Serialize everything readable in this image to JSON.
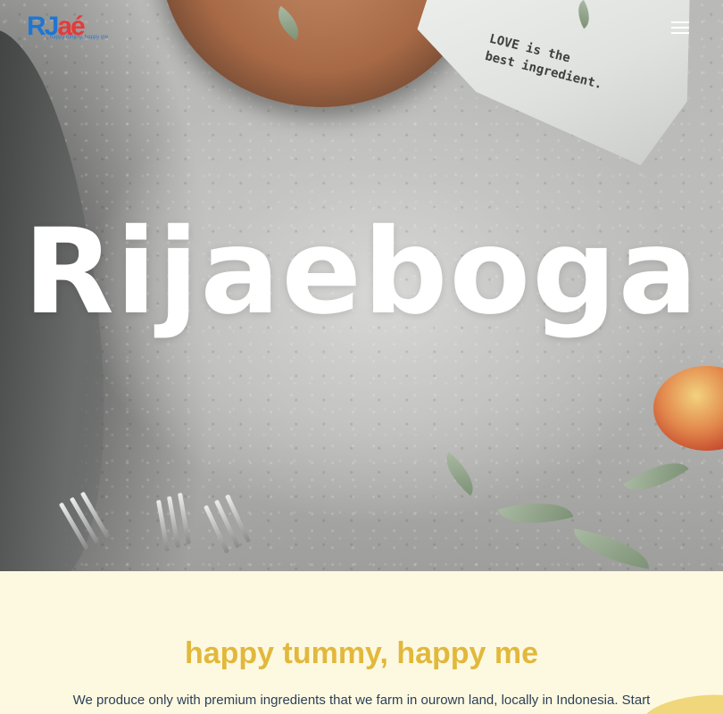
{
  "header": {
    "logo_text_a": "RJ",
    "logo_text_b": "aé",
    "logo_tagline": "happy tummy, happy me",
    "menu_icon": "hamburger-menu-icon"
  },
  "hero": {
    "title": "Rijaeboga",
    "napkin_lines": [
      "LOVE is the",
      "best ingredient."
    ]
  },
  "intro": {
    "title": "happy tummy, happy me",
    "text": "We produce only with premium ingredients that we farm in ourown land, locally in Indonesia. Start"
  },
  "colors": {
    "accent": "#e2b83c",
    "background": "#fdf9e1",
    "body_text": "#2b3f57",
    "logo_blue": "#1f76d2",
    "logo_red": "#e63a3a"
  }
}
